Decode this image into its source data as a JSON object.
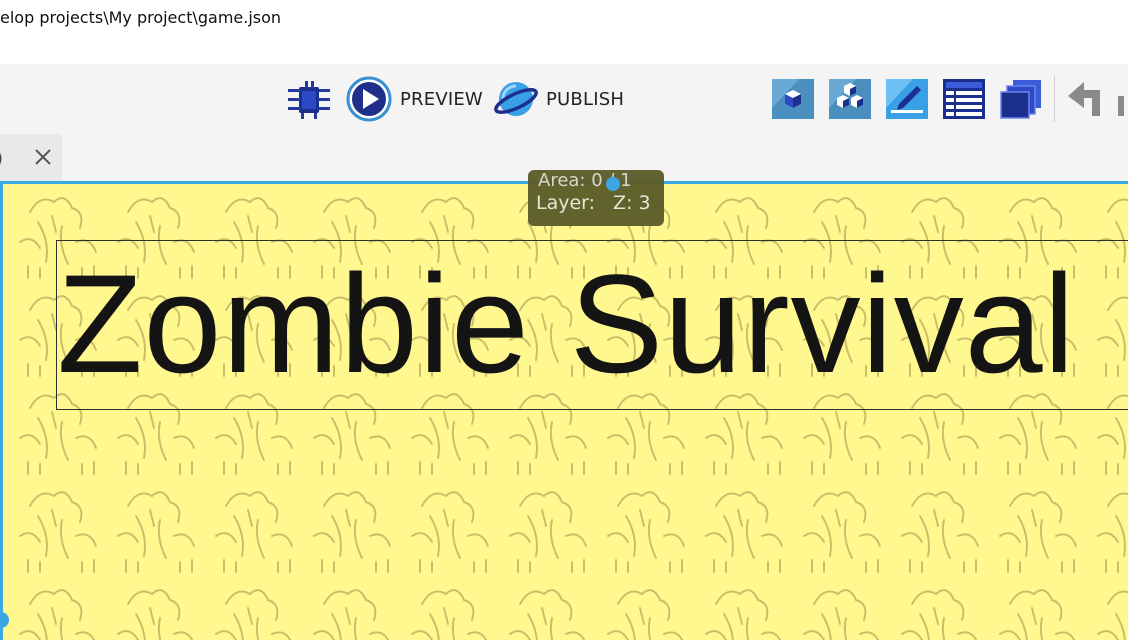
{
  "window": {
    "title": "elop projects\\My project\\game.json"
  },
  "toolbar": {
    "debug_icon": "bug-icon",
    "preview_label": "PREVIEW",
    "publish_label": "PUBLISH",
    "right_icons": [
      "object-editor-icon",
      "objects-groups-icon",
      "properties-icon",
      "layers-list-icon",
      "instances-stack-icon",
      "undo-icon"
    ]
  },
  "tabs": [
    {
      "label": ")",
      "close_icon": "close-icon"
    }
  ],
  "tooltip": {
    "line1": "Area: 0 / 1",
    "line2_label": "Layer:",
    "line2_value": "Z: 3"
  },
  "scene": {
    "title_text": "Zombie Survival",
    "background_color": "#fff88e",
    "selection_color": "#39a9e0"
  }
}
